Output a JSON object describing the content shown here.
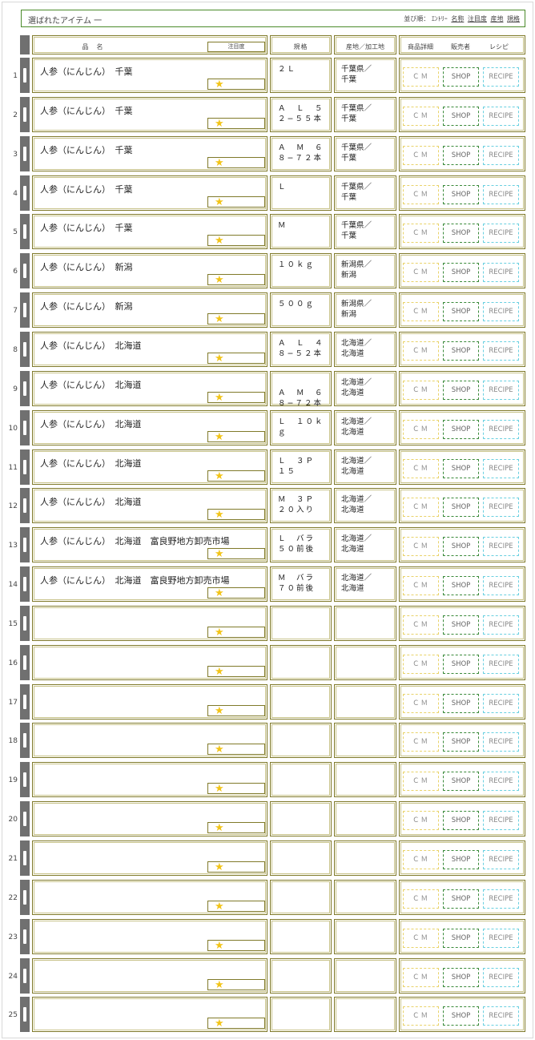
{
  "header": {
    "title": "選ばれたアイテム 一",
    "sort_label": "並び順：",
    "sort_entry": "ｴﾝﾄﾘｰ",
    "sort_name": "名称",
    "sort_attention": "注目度",
    "sort_origin": "産地",
    "sort_spec": "規格"
  },
  "columns": {
    "name": "品　名",
    "attention": "注目度",
    "spec": "規格",
    "origin": "産地／加工地",
    "detail": "商品詳細",
    "seller": "販売者",
    "recipe": "レシピ"
  },
  "buttons": {
    "cm": "ＣＭ",
    "shop": "SHOP",
    "recipe": "RECIPE"
  },
  "rows": [
    {
      "num": "1",
      "name": "人参（にんじん）　千葉",
      "spec": "２Ｌ",
      "origin": "千葉県／\n千葉"
    },
    {
      "num": "2",
      "name": "人参（にんじん）　千葉",
      "spec": "Ａ　Ｌ　５\n２−５５本",
      "origin": "千葉県／\n千葉"
    },
    {
      "num": "3",
      "name": "人参（にんじん）　千葉",
      "spec": "Ａ　Ｍ　６\n８−７２本",
      "origin": "千葉県／\n千葉"
    },
    {
      "num": "4",
      "name": "人参（にんじん）　千葉",
      "spec": "Ｌ",
      "origin": "千葉県／\n千葉"
    },
    {
      "num": "5",
      "name": "人参（にんじん）　千葉",
      "spec": "Ｍ",
      "origin": "千葉県／\n千葉"
    },
    {
      "num": "6",
      "name": "人参（にんじん）　新潟",
      "spec": "１０ｋｇ",
      "origin": "新潟県／\n新潟"
    },
    {
      "num": "7",
      "name": "人参（にんじん）　新潟",
      "spec": "５００ｇ",
      "origin": "新潟県／\n新潟"
    },
    {
      "num": "8",
      "name": "人参（にんじん）　北海道",
      "spec": "Ａ　Ｌ　４\n８−５２本",
      "origin": "北海道／\n北海道"
    },
    {
      "num": "9",
      "name": "人参（にんじん）　北海道",
      "spec": "\nＡ　Ｍ　６\n８−７２本",
      "origin": "北海道／\n北海道"
    },
    {
      "num": "10",
      "name": "人参（にんじん）　北海道",
      "spec": "Ｌ　１０ｋ\nｇ",
      "origin": "北海道／\n北海道"
    },
    {
      "num": "11",
      "name": "人参（にんじん）　北海道",
      "spec": "Ｌ　３Ｐ\n１５",
      "origin": "北海道／\n北海道"
    },
    {
      "num": "12",
      "name": "人参（にんじん）　北海道",
      "spec": "Ｍ　３Ｐ\n２０入り",
      "origin": "北海道／\n北海道"
    },
    {
      "num": "13",
      "name": "人参（にんじん）　北海道　富良野地方卸売市場",
      "spec": "Ｌ　バラ\n５０前後",
      "origin": "北海道／\n北海道"
    },
    {
      "num": "14",
      "name": "人参（にんじん）　北海道　富良野地方卸売市場",
      "spec": "Ｍ　バラ\n７０前後",
      "origin": "北海道／\n北海道"
    },
    {
      "num": "15",
      "name": "",
      "spec": "",
      "origin": ""
    },
    {
      "num": "16",
      "name": "",
      "spec": "",
      "origin": ""
    },
    {
      "num": "17",
      "name": "",
      "spec": "",
      "origin": ""
    },
    {
      "num": "18",
      "name": "",
      "spec": "",
      "origin": ""
    },
    {
      "num": "19",
      "name": "",
      "spec": "",
      "origin": ""
    },
    {
      "num": "20",
      "name": "",
      "spec": "",
      "origin": ""
    },
    {
      "num": "21",
      "name": "",
      "spec": "",
      "origin": ""
    },
    {
      "num": "22",
      "name": "",
      "spec": "",
      "origin": ""
    },
    {
      "num": "23",
      "name": "",
      "spec": "",
      "origin": ""
    },
    {
      "num": "24",
      "name": "",
      "spec": "",
      "origin": ""
    },
    {
      "num": "25",
      "name": "",
      "spec": "",
      "origin": ""
    }
  ],
  "colors": {
    "frame_border": "#807a2a",
    "header_border": "#4a8a2a",
    "star": "#f2c418",
    "cm_border": "#e9d36a",
    "shop_border": "#3a8a3a",
    "recipe_border": "#6ad0e0",
    "sidebar": "#707070"
  },
  "icons": {
    "star": "star-icon"
  }
}
